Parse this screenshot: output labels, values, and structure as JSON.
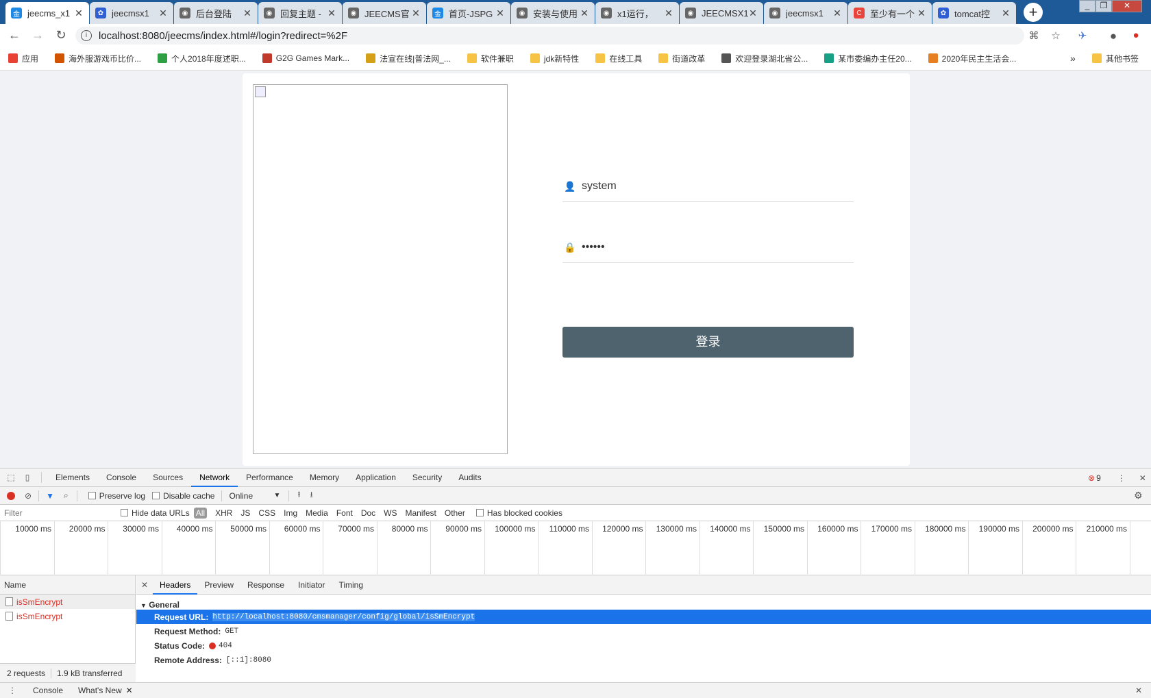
{
  "browser": {
    "tabs": [
      {
        "title": "jeecms_x1",
        "fav": "金",
        "color": "#1e88e5"
      },
      {
        "title": "jeecmsx1",
        "fav": "✿",
        "color": "#2f5fd3"
      },
      {
        "title": "后台登陆",
        "fav": "◉",
        "color": "#666666"
      },
      {
        "title": "回复主题 -",
        "fav": "◉",
        "color": "#666666"
      },
      {
        "title": "JEECMS官",
        "fav": "◉",
        "color": "#666666"
      },
      {
        "title": "首页-JSPG",
        "fav": "金",
        "color": "#1e88e5"
      },
      {
        "title": "安装与使用",
        "fav": "◉",
        "color": "#666666"
      },
      {
        "title": "x1运行，",
        "fav": "◉",
        "color": "#666666"
      },
      {
        "title": "JEECMSX1",
        "fav": "◉",
        "color": "#666666"
      },
      {
        "title": "jeecmsx1",
        "fav": "◉",
        "color": "#666666"
      },
      {
        "title": "至少有一个",
        "fav": "C",
        "color": "#e8453c"
      },
      {
        "title": "tomcat控",
        "fav": "✿",
        "color": "#2f5fd3"
      }
    ],
    "new_tab": "+",
    "url": "localhost:8080/jeecms/index.html#/login?redirect=%2F",
    "bookmarks": [
      {
        "label": "应用",
        "color": "#e94235"
      },
      {
        "label": "海外服游戏币比价...",
        "color": "#d35400"
      },
      {
        "label": "个人2018年度述职...",
        "color": "#2ea043"
      },
      {
        "label": "G2G Games Mark...",
        "color": "#c0392b"
      },
      {
        "label": "法宣在线|普法网_...",
        "color": "#d4a017"
      },
      {
        "label": "软件兼职",
        "folder": true
      },
      {
        "label": "jdk新特性",
        "folder": true
      },
      {
        "label": "在线工具",
        "folder": true
      },
      {
        "label": "街道改革",
        "folder": true
      },
      {
        "label": "欢迎登录湖北省公...",
        "color": "#555555"
      },
      {
        "label": "某市委编办主任20...",
        "color": "#16a085"
      },
      {
        "label": "2020年民主生活会...",
        "color": "#e67e22"
      }
    ],
    "bookmarks_overflow": "»",
    "other_bookmarks": "其他书签"
  },
  "login": {
    "username_value": "system",
    "password_value": "••••••",
    "submit_label": "登录"
  },
  "devtools": {
    "panels": [
      "Elements",
      "Console",
      "Sources",
      "Network",
      "Performance",
      "Memory",
      "Application",
      "Security",
      "Audits"
    ],
    "active_panel": "Network",
    "error_count": "9",
    "toolbar": {
      "preserve_log": "Preserve log",
      "disable_cache": "Disable cache",
      "throttle": "Online"
    },
    "filter": {
      "placeholder": "Filter",
      "hide_data_urls": "Hide data URLs",
      "types": [
        "All",
        "XHR",
        "JS",
        "CSS",
        "Img",
        "Media",
        "Font",
        "Doc",
        "WS",
        "Manifest",
        "Other"
      ],
      "has_blocked_cookies": "Has blocked cookies"
    },
    "timeline_ticks": [
      "10000 ms",
      "20000 ms",
      "30000 ms",
      "40000 ms",
      "50000 ms",
      "60000 ms",
      "70000 ms",
      "80000 ms",
      "90000 ms",
      "100000 ms",
      "110000 ms",
      "120000 ms",
      "130000 ms",
      "140000 ms",
      "150000 ms",
      "160000 ms",
      "170000 ms",
      "180000 ms",
      "190000 ms",
      "200000 ms",
      "210000 ms",
      "2..."
    ],
    "name_header": "Name",
    "requests": [
      "isSmEncrypt",
      "isSmEncrypt"
    ],
    "summary": {
      "requests": "2 requests",
      "transferred": "1.9 kB transferred"
    },
    "detail_tabs": [
      "Headers",
      "Preview",
      "Response",
      "Initiator",
      "Timing"
    ],
    "active_detail_tab": "Headers",
    "general_title": "General",
    "general": [
      {
        "key": "Request URL:",
        "value": "http://localhost:8080/cmsmanager/config/global/isSmEncrypt"
      },
      {
        "key": "Request Method:",
        "value": "GET"
      },
      {
        "key": "Status Code:",
        "value": "404"
      },
      {
        "key": "Remote Address:",
        "value": "[::1]:8080"
      }
    ],
    "drawer": {
      "console": "Console",
      "whats_new": "What's New"
    }
  }
}
